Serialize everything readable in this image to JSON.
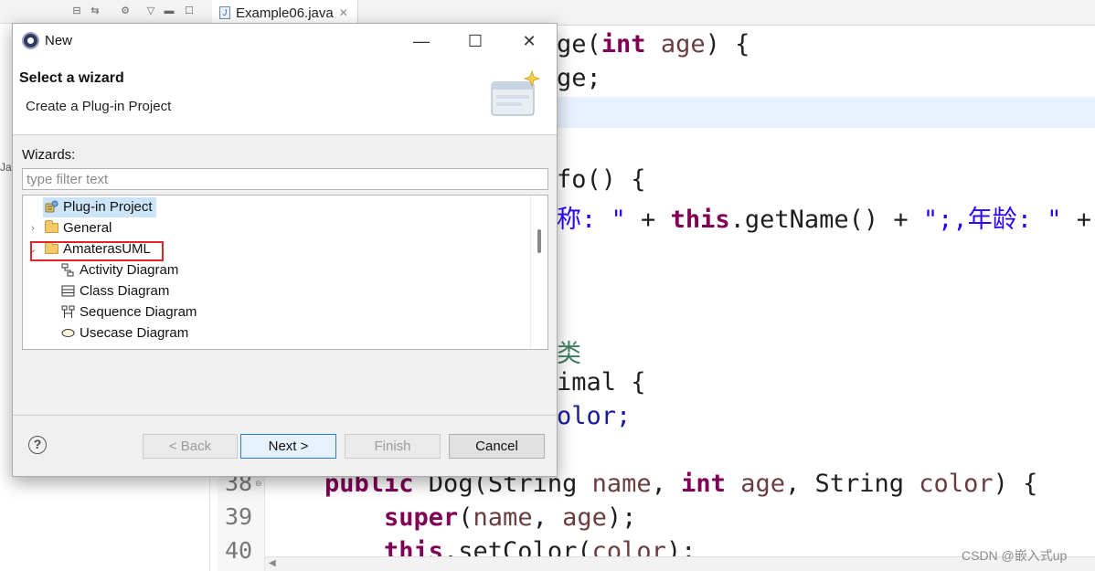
{
  "ide": {
    "editor_tab_label": "Example06.java",
    "left_cut_text": "Jav",
    "watermark": "CSDN @嵌入式up",
    "line_numbers": [
      "38",
      "39",
      "40"
    ]
  },
  "code": {
    "l1_a": "ge(",
    "l1_kw": "int",
    "l1_var": " age",
    "l1_b": ") {",
    "l2_a": "ge;",
    "l3_a": "fo() {",
    "l4_str1": "称: \"",
    "l4_b": " + ",
    "l4_kw": "this",
    "l4_c": ".getName() + ",
    "l4_str2": "\";,年龄: \"",
    "l4_d": " + t",
    "l5_cmt": "类",
    "l6_a": "imal {",
    "l7_a": "olor;",
    "l8_kw1": "public",
    "l8_a": " Dog(String ",
    "l8_var1": "name",
    "l8_b": ", ",
    "l8_kw2": "int",
    "l8_var2": " age",
    "l8_c": ", String ",
    "l8_var3": "color",
    "l8_d": ") {",
    "l9_kw": "super",
    "l9_a": "(",
    "l9_var1": "name",
    "l9_b": ", ",
    "l9_var2": "age",
    "l9_c": ");",
    "l10_kw": "this",
    "l10_a": ".setColor(",
    "l10_var": "color",
    "l10_b": ");"
  },
  "dialog": {
    "title": "New",
    "header_title": "Select a wizard",
    "header_description": "Create a Plug-in Project",
    "wizards_label": "Wizards:",
    "filter_placeholder": "type filter text",
    "tree": [
      {
        "label": "Plug-in Project",
        "icon": "plugin-icon",
        "selected": true
      },
      {
        "label": "General",
        "icon": "folder-icon",
        "expanded": false
      },
      {
        "label": "AmaterasUML",
        "icon": "folder-icon",
        "expanded": true
      },
      {
        "label": "Activity Diagram",
        "icon": "activity-diagram-icon"
      },
      {
        "label": "Class Diagram",
        "icon": "class-diagram-icon"
      },
      {
        "label": "Sequence Diagram",
        "icon": "sequence-diagram-icon"
      },
      {
        "label": "Usecase Diagram",
        "icon": "usecase-diagram-icon"
      }
    ],
    "buttons": {
      "help": "?",
      "back": "< Back",
      "next": "Next >",
      "finish": "Finish",
      "cancel": "Cancel"
    },
    "window_controls": {
      "minimize": "—",
      "maximize": "☐",
      "close": "✕"
    }
  },
  "colors": {
    "keyword": "#7f0055",
    "string": "#2a00ff",
    "variable": "#6a3e3e",
    "comment": "#3f7f5f",
    "highlight_box": "#e0252a",
    "selection": "#cce4f7"
  }
}
